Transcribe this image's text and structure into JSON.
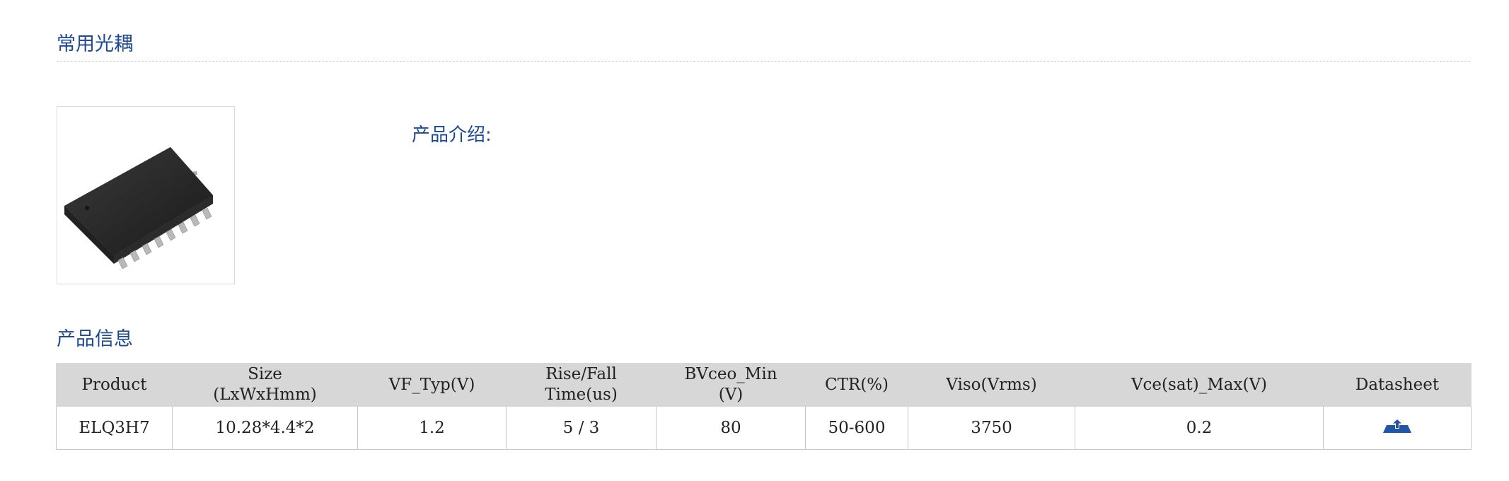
{
  "sections": {
    "common_title": "常用光耦",
    "info_title": "产品信息"
  },
  "product": {
    "image_icon": "soic-16-chip-image",
    "intro_label": "产品介绍:"
  },
  "table": {
    "headers": [
      [
        "Product"
      ],
      [
        "Size",
        "(LxWxHmm)"
      ],
      [
        "VF_Typ(V)"
      ],
      [
        "Rise/Fall",
        "Time(us)"
      ],
      [
        "BVceo_Min",
        "(V)"
      ],
      [
        "CTR(%)"
      ],
      [
        "Viso(Vrms)"
      ],
      [
        "Vce(sat)_Max(V)"
      ],
      [
        "Datasheet"
      ]
    ],
    "rows": [
      {
        "product": "ELQ3H7",
        "size": "10.28*4.4*2",
        "vf_typ": "1.2",
        "rise_fall": "5 / 3",
        "bvceo_min": "80",
        "ctr": "50-600",
        "viso": "3750",
        "vce_sat_max": "0.2",
        "datasheet_icon": "download-icon"
      }
    ]
  },
  "colors": {
    "title_blue": "#1c4a93",
    "header_bg": "#d7d7d7",
    "icon_blue": "#1f56a8"
  }
}
